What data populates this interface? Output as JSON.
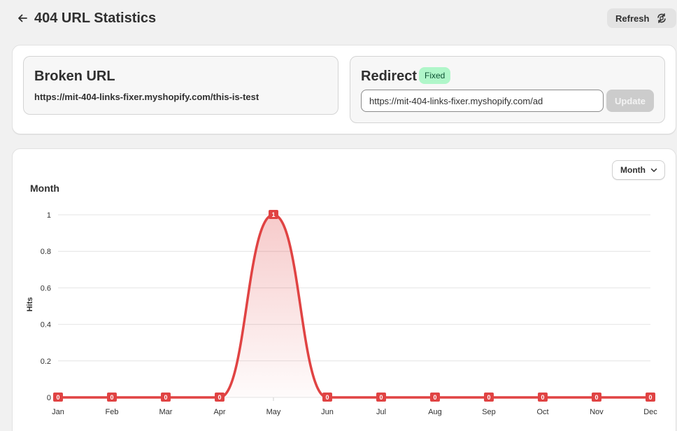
{
  "header": {
    "title": "404 URL Statistics",
    "refresh_label": "Refresh"
  },
  "broken": {
    "title": "Broken URL",
    "url": "https://mit-404-links-fixer.myshopify.com/this-is-test"
  },
  "redirect": {
    "title": "Redirect",
    "badge": "Fixed",
    "input_value": "https://mit-404-links-fixer.myshopify.com/ad",
    "update_label": "Update"
  },
  "chart_section": {
    "period_select": "Month",
    "title": "Month"
  },
  "colors": {
    "series": "#e04343",
    "badge_bg": "#aff6c9",
    "grid": "#e4e4e4"
  },
  "chart_data": {
    "type": "area",
    "title": "Month",
    "xlabel": "",
    "ylabel": "Hits",
    "categories": [
      "Jan",
      "Feb",
      "Mar",
      "Apr",
      "May",
      "Jun",
      "Jul",
      "Aug",
      "Sep",
      "Oct",
      "Nov",
      "Dec"
    ],
    "series": [
      {
        "values": [
          0,
          0,
          0,
          0,
          1,
          0,
          0,
          0,
          0,
          0,
          0,
          0
        ]
      }
    ],
    "yticks": [
      "0",
      "0.2",
      "0.4",
      "0.6",
      "0.8",
      "1"
    ],
    "ylim": [
      0,
      1
    ],
    "grid": true,
    "data_labels": true,
    "legend": "none"
  }
}
